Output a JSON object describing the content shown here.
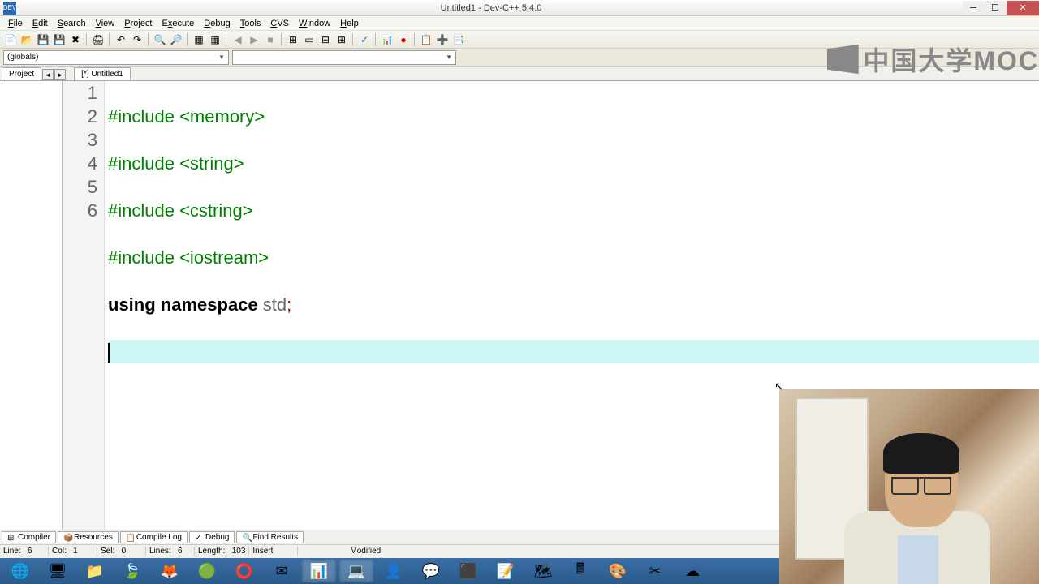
{
  "window": {
    "title": "Untitled1 - Dev-C++ 5.4.0",
    "app_icon": "DEV"
  },
  "menu": {
    "items": [
      {
        "label": "File",
        "u": "F"
      },
      {
        "label": "Edit",
        "u": "E"
      },
      {
        "label": "Search",
        "u": "S"
      },
      {
        "label": "View",
        "u": "V"
      },
      {
        "label": "Project",
        "u": "P"
      },
      {
        "label": "Execute",
        "u": "E"
      },
      {
        "label": "Debug",
        "u": "D"
      },
      {
        "label": "Tools",
        "u": "T"
      },
      {
        "label": "CVS",
        "u": "C"
      },
      {
        "label": "Window",
        "u": "W"
      },
      {
        "label": "Help",
        "u": "H"
      }
    ]
  },
  "combos": {
    "scope": "(globals)",
    "member": ""
  },
  "side": {
    "project_tab": "Project",
    "file_tab": "[*] Untitled1"
  },
  "code": {
    "lines": [
      {
        "n": "1",
        "pp": "#include ",
        "arg": "<memory>"
      },
      {
        "n": "2",
        "pp": "#include ",
        "arg": "<string>"
      },
      {
        "n": "3",
        "pp": "#include ",
        "arg": "<cstring>"
      },
      {
        "n": "4",
        "pp": "#include ",
        "arg": "<iostream>"
      },
      {
        "n": "5",
        "kw1": "using",
        "kw2": "namespace",
        "id": "std",
        "semi": ";"
      },
      {
        "n": "6"
      }
    ]
  },
  "bottom_tabs": {
    "compiler": "Compiler",
    "resources": "Resources",
    "compile_log": "Compile Log",
    "debug": "Debug",
    "find_results": "Find Results"
  },
  "status": {
    "line_lbl": "Line:",
    "line": "6",
    "col_lbl": "Col:",
    "col": "1",
    "sel_lbl": "Sel:",
    "sel": "0",
    "lines_lbl": "Lines:",
    "lines": "6",
    "length_lbl": "Length:",
    "length": "103",
    "insert": "Insert",
    "modified": "Modified"
  },
  "watermark": "中国大学MOC"
}
